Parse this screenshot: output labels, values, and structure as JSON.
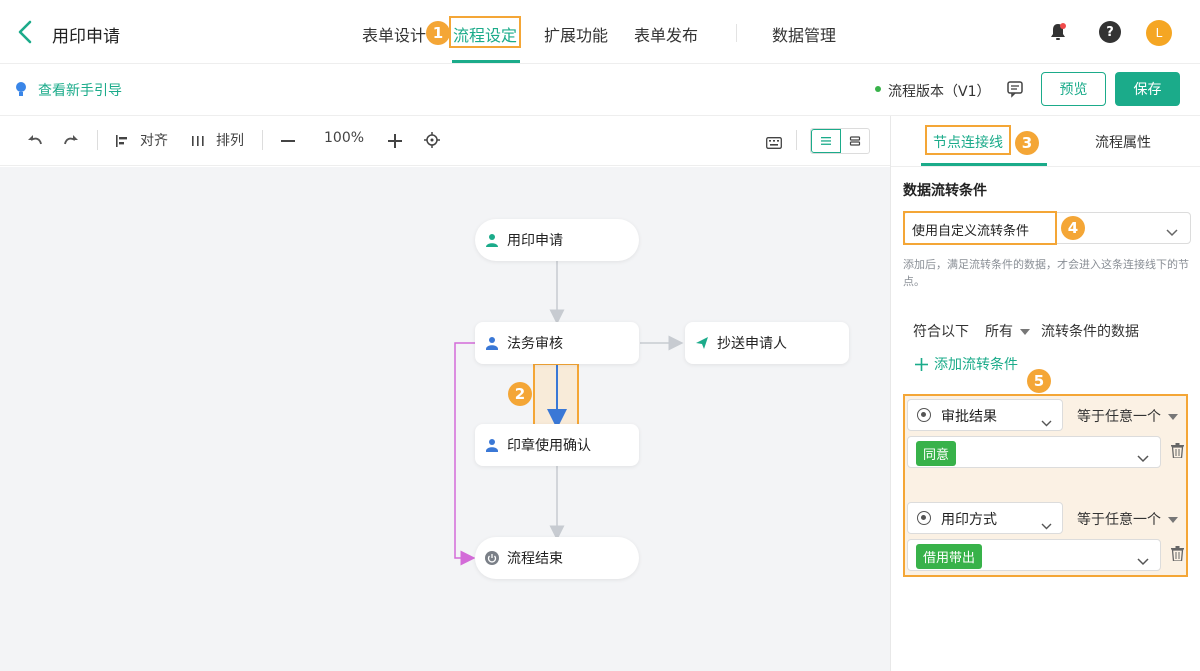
{
  "header": {
    "title": "用印申请",
    "tabs": [
      {
        "label": "表单设计"
      },
      {
        "label": "流程设定"
      },
      {
        "label": "扩展功能"
      },
      {
        "label": "表单发布"
      },
      {
        "label": "数据管理"
      }
    ],
    "avatar_letter": "L"
  },
  "subbar": {
    "guide_label": "查看新手引导",
    "version_label": "流程版本（V1）",
    "preview_label": "预览",
    "save_label": "保存"
  },
  "toolbar": {
    "align_label": "对齐",
    "arrange_label": "排列",
    "zoom": "100%"
  },
  "flow": {
    "nodes": {
      "start": "用印申请",
      "legal": "法务审核",
      "cc": "抄送申请人",
      "seal": "印章使用确认",
      "end": "流程结束"
    }
  },
  "annotations": [
    "1",
    "2",
    "3",
    "4",
    "5"
  ],
  "panel": {
    "tabs": [
      {
        "label": "节点连接线"
      },
      {
        "label": "流程属性"
      }
    ],
    "section_title": "数据流转条件",
    "condition_mode": "使用自定义流转条件",
    "hint": "添加后，满足流转条件的数据，才会进入这条连接线下的节点。",
    "match_prefix": "符合以下",
    "match_mode": "所有",
    "match_suffix": "流转条件的数据",
    "add_condition_label": "添加流转条件",
    "conditions": [
      {
        "field": "审批结果",
        "operator": "等于任意一个",
        "value": "同意"
      },
      {
        "field": "用印方式",
        "operator": "等于任意一个",
        "value": "借用带出"
      }
    ]
  },
  "colors": {
    "accent": "#1bab8a",
    "highlight": "#f4a636",
    "tag_green": "#38b24a",
    "branch_line": "#d36bd8",
    "selected_line": "#3a78d6"
  }
}
